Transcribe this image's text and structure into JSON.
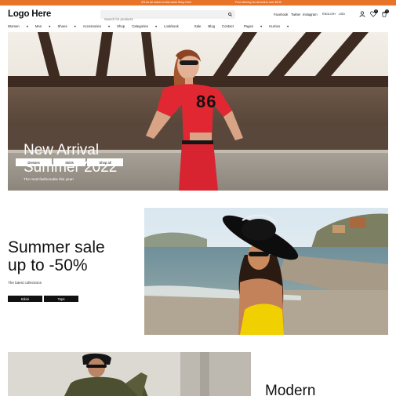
{
  "announcement": {
    "left": "4% for all orders in this week Shop Here",
    "right": "Free delivery for all orders over $100"
  },
  "header": {
    "logo": "Logo Here",
    "search_placeholder": "Search for products",
    "links": [
      "Facebook",
      "Twitter",
      "Instagram"
    ],
    "language": "ENGLISH",
    "currency": "USD",
    "wishlist_count": "0",
    "cart_count": "0"
  },
  "nav": [
    "Women",
    "Men",
    "Shoes",
    "Accessories",
    "Shop",
    "Categories",
    "Lookbook",
    "Sale",
    "Blog",
    "Contact",
    "Pages",
    "Hurries"
  ],
  "hero": {
    "title_line1": "New Arrival",
    "title_line2": "Summer 2022",
    "subtitle": "The most fashionable this year!",
    "buttons": [
      "Dresses",
      "Skirts",
      "Shop all"
    ],
    "jersey_number": "86"
  },
  "sale": {
    "title_line1": "Summer sale",
    "title_line2": "up to -50%",
    "subtitle": "The latest collections",
    "buttons": [
      "Bikini",
      "Tops"
    ]
  },
  "bottom": {
    "heading": "Modern"
  },
  "colors": {
    "accent": "#e8742a",
    "dark": "#111111"
  }
}
